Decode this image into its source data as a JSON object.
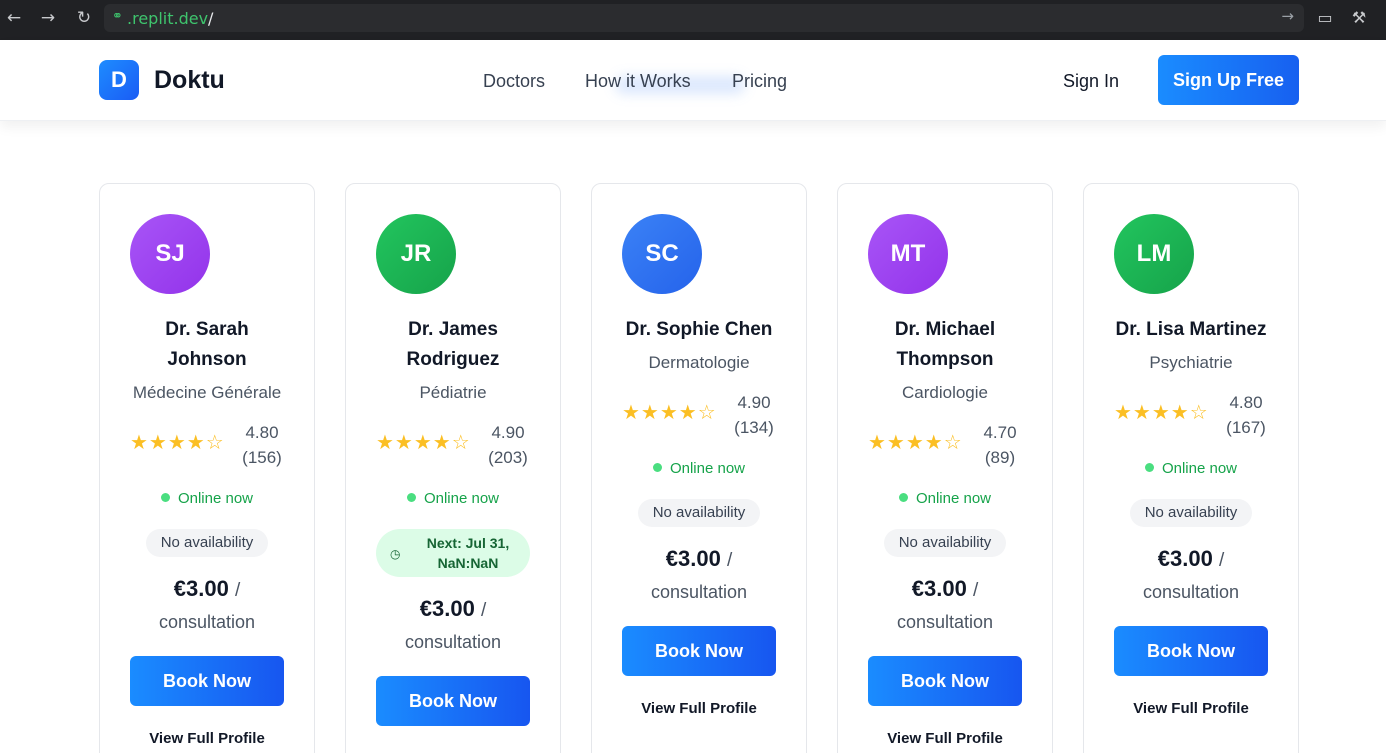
{
  "browser": {
    "url_host": ".replit.dev",
    "url_path": "/"
  },
  "header": {
    "logo_letter": "D",
    "brand": "Doktu",
    "nav": [
      "Doctors",
      "How it Works",
      "Pricing"
    ],
    "sign_in": "Sign In",
    "sign_up": "Sign Up Free"
  },
  "colors": {
    "primary": "#1a8cff",
    "purple_avatar": "#9b3df0",
    "green_avatar": "#1fb45a",
    "blue_avatar": "#2f74f0",
    "online_green": "#16a34a",
    "star_yellow": "#fbbf24"
  },
  "doctors": [
    {
      "initials": "SJ",
      "name_line1": "Dr. Sarah",
      "name_line2": "Johnson",
      "specialty": "Médecine Générale",
      "rating": "4.80",
      "reviews": "(156)",
      "stars_filled": 4,
      "status": "Online now",
      "availability": "No availability",
      "price": "€3.00",
      "price_sep": "/",
      "unit": "consultation",
      "book": "Book Now",
      "profile": "View Full Profile"
    },
    {
      "initials": "JR",
      "name_line1": "Dr. James",
      "name_line2": "Rodriguez",
      "specialty": "Pédiatrie",
      "rating": "4.90",
      "reviews": "(203)",
      "stars_filled": 4,
      "status": "Online now",
      "availability_line1": "Next: Jul 31,",
      "availability_line2": "NaN:NaN",
      "price": "€3.00",
      "price_sep": "/",
      "unit": "consultation",
      "book": "Book Now"
    },
    {
      "initials": "SC",
      "name_line1": "Dr. Sophie Chen",
      "specialty": "Dermatologie",
      "rating": "4.90",
      "reviews": "(134)",
      "stars_filled": 4,
      "status": "Online now",
      "availability": "No availability",
      "price": "€3.00",
      "price_sep": "/",
      "unit": "consultation",
      "book": "Book Now",
      "profile": "View Full Profile"
    },
    {
      "initials": "MT",
      "name_line1": "Dr. Michael",
      "name_line2": "Thompson",
      "specialty": "Cardiologie",
      "rating": "4.70",
      "reviews": "(89)",
      "stars_filled": 4,
      "status": "Online now",
      "availability": "No availability",
      "price": "€3.00",
      "price_sep": "/",
      "unit": "consultation",
      "book": "Book Now",
      "profile": "View Full Profile"
    },
    {
      "initials": "LM",
      "name_line1": "Dr. Lisa Martinez",
      "specialty": "Psychiatrie",
      "rating": "4.80",
      "reviews": "(167)",
      "stars_filled": 4,
      "status": "Online now",
      "availability": "No availability",
      "price": "€3.00",
      "price_sep": "/",
      "unit": "consultation",
      "book": "Book Now",
      "profile": "View Full Profile"
    }
  ]
}
